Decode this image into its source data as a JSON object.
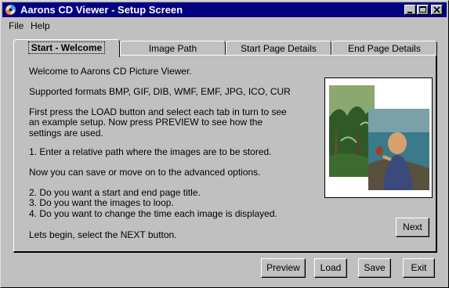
{
  "window": {
    "title": "Aarons CD Viewer - Setup Screen"
  },
  "menu": {
    "file": "File",
    "help": "Help"
  },
  "tabs": [
    "Start - Welcome",
    "Image Path",
    "Start Page Details",
    "End Page Details"
  ],
  "content": {
    "welcome": "Welcome to Aarons CD Picture Viewer.",
    "formats": "Supported formats BMP, GIF, DIB, WMF, EMF, JPG, ICO, CUR",
    "instr1": "First press the LOAD button and select each tab in turn to see",
    "instr2": "an example setup. Now press PREVIEW to see how the",
    "instr3": "settings are used.",
    "step1": "1. Enter a relative path where the images are to be stored.",
    "save_note": "Now you can save or move on to the advanced options.",
    "step2": "2. Do you want a start and end page title.",
    "step3": "3. Do you want the images to loop.",
    "step4": "4. Do you want to change the time each image is displayed.",
    "begin": "Lets begin, select the NEXT button."
  },
  "buttons": {
    "next": "Next",
    "preview": "Preview",
    "load": "Load",
    "save": "Save",
    "exit": "Exit"
  },
  "icons": {
    "app": "cd-icon",
    "minimize": "minimize-icon",
    "maximize": "maximize-icon",
    "close": "close-icon"
  },
  "colors": {
    "titlebar": "#000080",
    "face": "#c0c0c0"
  }
}
